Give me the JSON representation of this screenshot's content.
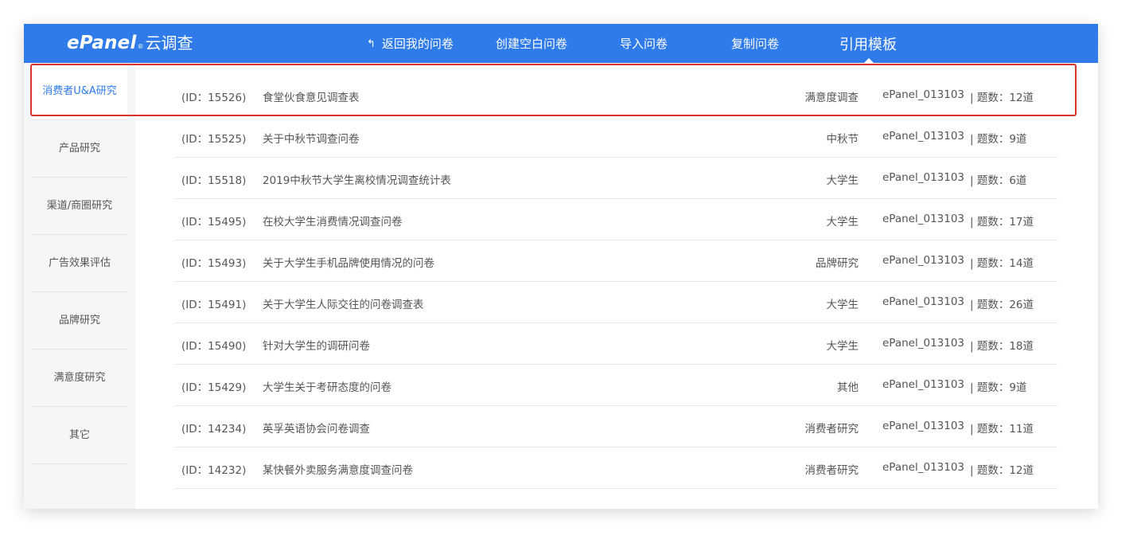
{
  "header": {
    "logo_brand": "ePanel",
    "logo_reg": "®",
    "logo_text": "云调查",
    "nav": [
      {
        "label": "返回我的问卷",
        "icon": "back-arrow-icon"
      },
      {
        "label": "创建空白问卷"
      },
      {
        "label": "导入问卷"
      },
      {
        "label": "复制问卷"
      },
      {
        "label": "引用模板",
        "active": true
      }
    ]
  },
  "sidebar": {
    "items": [
      {
        "label": "消费者U&A研究",
        "active": true
      },
      {
        "label": "产品研究"
      },
      {
        "label": "渠道/商圈研究"
      },
      {
        "label": "广告效果评估"
      },
      {
        "label": "品牌研究"
      },
      {
        "label": "满意度研究"
      },
      {
        "label": "其它"
      }
    ]
  },
  "templates": {
    "rows": [
      {
        "id": "(ID：15526)",
        "title": "食堂伙食意见调查表",
        "category": "满意度调查",
        "author": "ePanel_013103",
        "count": "|  题数：12道"
      },
      {
        "id": "(ID：15525)",
        "title": "关于中秋节调查问卷",
        "category": "中秋节",
        "author": "ePanel_013103",
        "count": "|  题数：9道"
      },
      {
        "id": "(ID：15518)",
        "title": "2019中秋节大学生离校情况调查统计表",
        "category": "大学生",
        "author": "ePanel_013103",
        "count": "|  题数：6道"
      },
      {
        "id": "(ID：15495)",
        "title": "在校大学生消费情况调查问卷",
        "category": "大学生",
        "author": "ePanel_013103",
        "count": "|  题数：17道"
      },
      {
        "id": "(ID：15493)",
        "title": "关于大学生手机品牌使用情况的问卷",
        "category": "品牌研究",
        "author": "ePanel_013103",
        "count": "|  题数：14道"
      },
      {
        "id": "(ID：15491)",
        "title": "关于大学生人际交往的问卷调查表",
        "category": "大学生",
        "author": "ePanel_013103",
        "count": "|  题数：26道"
      },
      {
        "id": "(ID：15490)",
        "title": "针对大学生的调研问卷",
        "category": "大学生",
        "author": "ePanel_013103",
        "count": "|  题数：18道"
      },
      {
        "id": "(ID：15429)",
        "title": "大学生关于考研态度的问卷",
        "category": "其他",
        "author": "ePanel_013103",
        "count": "|  题数：9道"
      },
      {
        "id": "(ID：14234)",
        "title": "英孚英语协会问卷调查",
        "category": "消费者研究",
        "author": "ePanel_013103",
        "count": "|  题数：11道"
      },
      {
        "id": "(ID：14232)",
        "title": "某快餐外卖服务满意度调查问卷",
        "category": "消费者研究",
        "author": "ePanel_013103",
        "count": "|  题数：12道"
      }
    ]
  },
  "colors": {
    "header_bg": "#2f7bea",
    "sidebar_bg": "#f5f6f8",
    "active_text": "#2f7bea",
    "highlight_border": "#d9322a"
  }
}
